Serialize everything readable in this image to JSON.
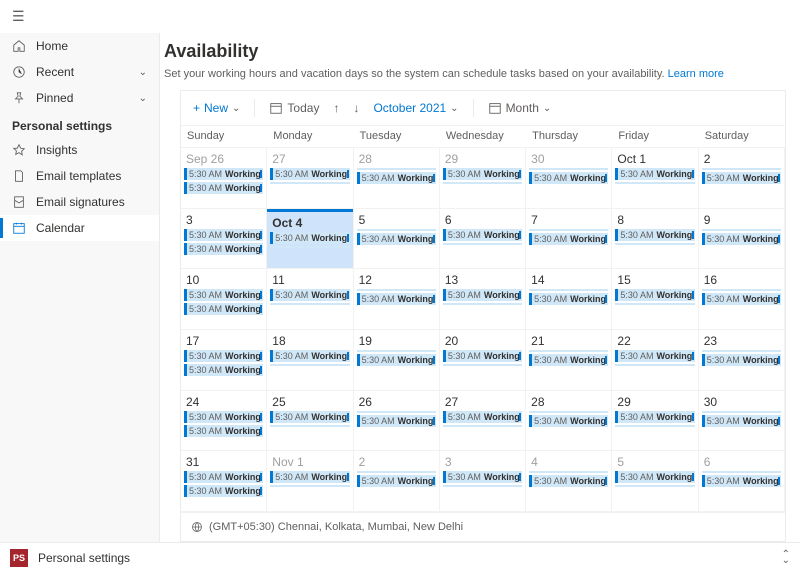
{
  "nav": {
    "home": "Home",
    "recent": "Recent",
    "pinned": "Pinned",
    "sectionHead": "Personal settings",
    "insights": "Insights",
    "emailTemplates": "Email templates",
    "emailSignatures": "Email signatures",
    "calendar": "Calendar"
  },
  "page": {
    "title": "Availability",
    "desc1": "Set your working hours and vacation days so the system can schedule tasks based on your availability. ",
    "learnMore": "Learn more"
  },
  "toolbar": {
    "new": "New",
    "today": "Today",
    "month": "October 2021",
    "view": "Month"
  },
  "dow": [
    "Sunday",
    "Monday",
    "Tuesday",
    "Wednesday",
    "Thursday",
    "Friday",
    "Saturday"
  ],
  "weeks": [
    [
      {
        "label": "Sep 26",
        "dim": true,
        "ev": [
          {
            "t": "5:30 AM",
            "w": "Working",
            "start": true
          },
          {
            "t": "5:30 AM",
            "w": "Working",
            "start": true
          }
        ]
      },
      {
        "label": "27",
        "dim": true,
        "ev": [
          {
            "t": "5:30 AM",
            "w": "Working",
            "start": true
          },
          {
            "cont": true
          }
        ]
      },
      {
        "label": "28",
        "dim": true,
        "ev": [
          {
            "cont": true
          },
          {
            "t": "5:30 AM",
            "w": "Working",
            "start": true
          }
        ]
      },
      {
        "label": "29",
        "dim": true,
        "ev": [
          {
            "t": "5:30 AM",
            "w": "Working",
            "start": true
          },
          {
            "cont": true
          }
        ]
      },
      {
        "label": "30",
        "dim": true,
        "ev": [
          {
            "cont": true
          },
          {
            "t": "5:30 AM",
            "w": "Working",
            "start": true
          }
        ]
      },
      {
        "label": "Oct 1",
        "ev": [
          {
            "t": "5:30 AM",
            "w": "Working",
            "start": true
          },
          {
            "cont": true
          }
        ]
      },
      {
        "label": "2",
        "ev": [
          {
            "cont": true
          },
          {
            "t": "5:30 AM",
            "w": "Working",
            "start": true
          }
        ]
      }
    ],
    [
      {
        "label": "3",
        "ev": [
          {
            "t": "5:30 AM",
            "w": "Working",
            "start": true
          },
          {
            "t": "5:30 AM",
            "w": "Working",
            "start": true
          }
        ]
      },
      {
        "label": "Oct 4",
        "today": true,
        "ev": [
          {
            "t": "5:30 AM",
            "w": "Working",
            "start": true
          },
          {
            "cont": true
          }
        ]
      },
      {
        "label": "5",
        "ev": [
          {
            "cont": true
          },
          {
            "t": "5:30 AM",
            "w": "Working",
            "start": true
          }
        ]
      },
      {
        "label": "6",
        "ev": [
          {
            "t": "5:30 AM",
            "w": "Working",
            "start": true
          },
          {
            "cont": true
          }
        ]
      },
      {
        "label": "7",
        "ev": [
          {
            "cont": true
          },
          {
            "t": "5:30 AM",
            "w": "Working",
            "start": true
          }
        ]
      },
      {
        "label": "8",
        "ev": [
          {
            "t": "5:30 AM",
            "w": "Working",
            "start": true
          },
          {
            "cont": true
          }
        ]
      },
      {
        "label": "9",
        "ev": [
          {
            "cont": true
          },
          {
            "t": "5:30 AM",
            "w": "Working",
            "start": true
          }
        ]
      }
    ],
    [
      {
        "label": "10",
        "ev": [
          {
            "t": "5:30 AM",
            "w": "Working",
            "start": true
          },
          {
            "t": "5:30 AM",
            "w": "Working",
            "start": true
          }
        ]
      },
      {
        "label": "11",
        "ev": [
          {
            "t": "5:30 AM",
            "w": "Working",
            "start": true
          },
          {
            "cont": true
          }
        ]
      },
      {
        "label": "12",
        "ev": [
          {
            "cont": true
          },
          {
            "t": "5:30 AM",
            "w": "Working",
            "start": true
          }
        ]
      },
      {
        "label": "13",
        "ev": [
          {
            "t": "5:30 AM",
            "w": "Working",
            "start": true
          },
          {
            "cont": true
          }
        ]
      },
      {
        "label": "14",
        "ev": [
          {
            "cont": true
          },
          {
            "t": "5:30 AM",
            "w": "Working",
            "start": true
          }
        ]
      },
      {
        "label": "15",
        "ev": [
          {
            "t": "5:30 AM",
            "w": "Working",
            "start": true
          },
          {
            "cont": true
          }
        ]
      },
      {
        "label": "16",
        "ev": [
          {
            "cont": true
          },
          {
            "t": "5:30 AM",
            "w": "Working",
            "start": true
          }
        ]
      }
    ],
    [
      {
        "label": "17",
        "ev": [
          {
            "t": "5:30 AM",
            "w": "Working",
            "start": true
          },
          {
            "t": "5:30 AM",
            "w": "Working",
            "start": true
          }
        ]
      },
      {
        "label": "18",
        "ev": [
          {
            "t": "5:30 AM",
            "w": "Working",
            "start": true
          },
          {
            "cont": true
          }
        ]
      },
      {
        "label": "19",
        "ev": [
          {
            "cont": true
          },
          {
            "t": "5:30 AM",
            "w": "Working",
            "start": true
          }
        ]
      },
      {
        "label": "20",
        "ev": [
          {
            "t": "5:30 AM",
            "w": "Working",
            "start": true
          },
          {
            "cont": true
          }
        ]
      },
      {
        "label": "21",
        "ev": [
          {
            "cont": true
          },
          {
            "t": "5:30 AM",
            "w": "Working",
            "start": true
          }
        ]
      },
      {
        "label": "22",
        "ev": [
          {
            "t": "5:30 AM",
            "w": "Working",
            "start": true
          },
          {
            "cont": true
          }
        ]
      },
      {
        "label": "23",
        "ev": [
          {
            "cont": true
          },
          {
            "t": "5:30 AM",
            "w": "Working",
            "start": true
          }
        ]
      }
    ],
    [
      {
        "label": "24",
        "ev": [
          {
            "t": "5:30 AM",
            "w": "Working",
            "start": true
          },
          {
            "t": "5:30 AM",
            "w": "Working",
            "start": true
          }
        ]
      },
      {
        "label": "25",
        "ev": [
          {
            "t": "5:30 AM",
            "w": "Working",
            "start": true
          },
          {
            "cont": true
          }
        ]
      },
      {
        "label": "26",
        "ev": [
          {
            "cont": true
          },
          {
            "t": "5:30 AM",
            "w": "Working",
            "start": true
          }
        ]
      },
      {
        "label": "27",
        "ev": [
          {
            "t": "5:30 AM",
            "w": "Working",
            "start": true
          },
          {
            "cont": true
          }
        ]
      },
      {
        "label": "28",
        "ev": [
          {
            "cont": true
          },
          {
            "t": "5:30 AM",
            "w": "Working",
            "start": true
          }
        ]
      },
      {
        "label": "29",
        "ev": [
          {
            "t": "5:30 AM",
            "w": "Working",
            "start": true
          },
          {
            "cont": true
          }
        ]
      },
      {
        "label": "30",
        "ev": [
          {
            "cont": true
          },
          {
            "t": "5:30 AM",
            "w": "Working",
            "start": true
          }
        ]
      }
    ],
    [
      {
        "label": "31",
        "ev": [
          {
            "t": "5:30 AM",
            "w": "Working",
            "start": true
          },
          {
            "t": "5:30 AM",
            "w": "Working",
            "start": true
          }
        ]
      },
      {
        "label": "Nov 1",
        "dim": true,
        "ev": [
          {
            "t": "5:30 AM",
            "w": "Working",
            "start": true
          },
          {
            "cont": true
          }
        ]
      },
      {
        "label": "2",
        "dim": true,
        "ev": [
          {
            "cont": true
          },
          {
            "t": "5:30 AM",
            "w": "Working",
            "start": true
          }
        ]
      },
      {
        "label": "3",
        "dim": true,
        "ev": [
          {
            "t": "5:30 AM",
            "w": "Working",
            "start": true
          },
          {
            "cont": true
          }
        ]
      },
      {
        "label": "4",
        "dim": true,
        "ev": [
          {
            "cont": true
          },
          {
            "t": "5:30 AM",
            "w": "Working",
            "start": true
          }
        ]
      },
      {
        "label": "5",
        "dim": true,
        "ev": [
          {
            "t": "5:30 AM",
            "w": "Working",
            "start": true
          },
          {
            "cont": true
          }
        ]
      },
      {
        "label": "6",
        "dim": true,
        "ev": [
          {
            "cont": true
          },
          {
            "t": "5:30 AM",
            "w": "Working",
            "start": true
          }
        ]
      }
    ]
  ],
  "tz": "(GMT+05:30) Chennai, Kolkata, Mumbai, New Delhi",
  "bottomBar": {
    "badge": "PS",
    "label": "Personal settings"
  }
}
